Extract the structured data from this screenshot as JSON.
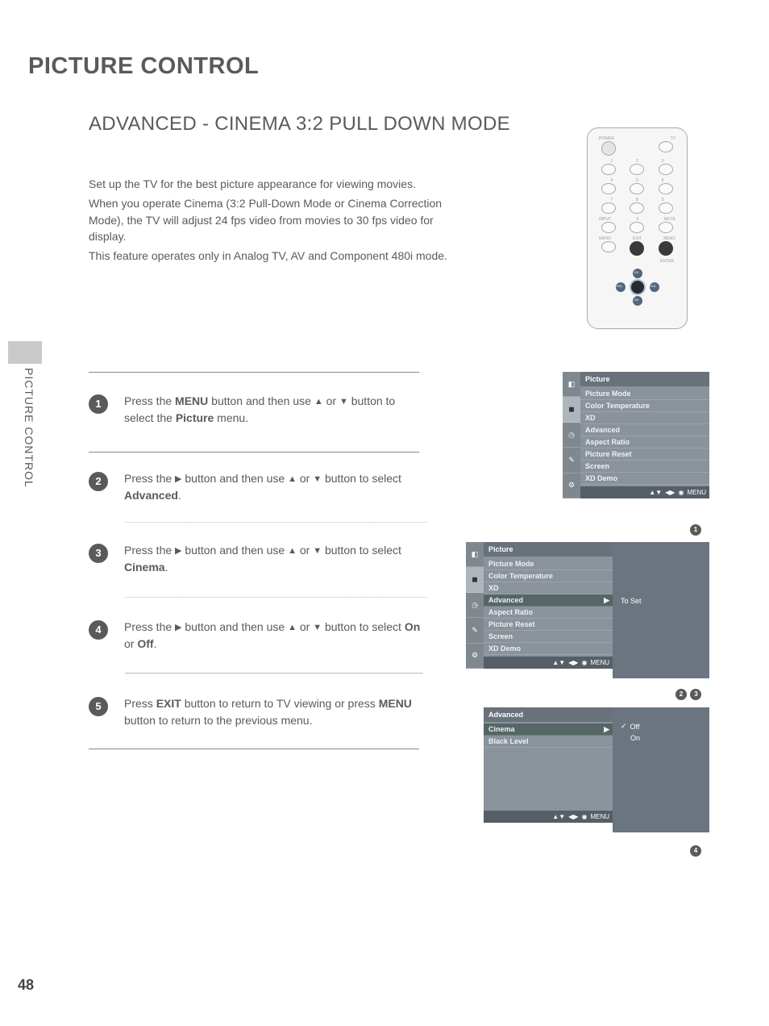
{
  "sideLabel": "PICTURE CONTROL",
  "pageTitle": "PICTURE CONTROL",
  "sectionTitle": "ADVANCED - CINEMA 3:2 PULL DOWN MODE",
  "intro": {
    "p1": "Set up the TV for the best picture appearance for viewing movies.",
    "p2": "When you operate Cinema (3:2 Pull-Down Mode or Cinema Correction Mode), the TV will adjust 24 fps video from movies to 30 fps video for display.",
    "p3": "This feature operates only in Analog TV, AV and Component 480i mode."
  },
  "remote": {
    "power": "POWER",
    "tv": "TV",
    "input": "INPUT",
    "mute": "MUTE",
    "ratio": "RATIO",
    "exit": "EXIT",
    "menu": "MENU",
    "enter": "ENTER",
    "ch": "CH",
    "vol": "VOL"
  },
  "steps": {
    "s1a": "Press the ",
    "s1b": "MENU",
    "s1c": " button and then use ",
    "s1d": " or ",
    "s1e": " button to select the ",
    "s1f": "Picture",
    "s1g": " menu.",
    "s2a": "Press the ",
    "s2b": " button and then use ",
    "s2c": " or ",
    "s2d": " button to select ",
    "s2e": "Advanced",
    "s2f": ".",
    "s3a": "Press the ",
    "s3b": " button and then use ",
    "s3c": " or ",
    "s3d": " button to select ",
    "s3e": "Cinema",
    "s3f": ".",
    "s4a": "Press the ",
    "s4b": " button and then use ",
    "s4c": " or ",
    "s4d": " button to select  ",
    "s4e": "On",
    "s4f": " or ",
    "s4g": "Off",
    "s4h": ".",
    "s5a": "Press ",
    "s5b": "EXIT",
    "s5c": " button to return to TV viewing or press ",
    "s5d": "MENU",
    "s5e": " button to return to the previous menu."
  },
  "osd1": {
    "title": "Picture",
    "items": [
      "Picture Mode",
      "Color Temperature",
      "XD",
      "Advanced",
      "Aspect Ratio",
      "Picture Reset",
      "Screen",
      "XD Demo"
    ],
    "footerMenu": "MENU"
  },
  "osd2": {
    "title": "Picture",
    "items": [
      "Picture Mode",
      "Color Temperature",
      "XD",
      "Advanced",
      "Aspect Ratio",
      "Picture Reset",
      "Screen",
      "XD Demo"
    ],
    "highlight": "Advanced",
    "right": "To Set",
    "footerMenu": "MENU"
  },
  "osd3": {
    "title": "Advanced",
    "items": [
      "Cinema",
      "Black Level"
    ],
    "highlight": "Cinema",
    "rightOptions": [
      "Off",
      "On"
    ],
    "check": "✓",
    "footerMenu": "MENU"
  },
  "badges": {
    "b1": "1",
    "b2": "2",
    "b3": "3",
    "b4": "4",
    "b5": "5"
  },
  "callouts": {
    "c1": "1",
    "c2": "2",
    "c3": "3",
    "c4": "4"
  },
  "pageNumber": "48"
}
